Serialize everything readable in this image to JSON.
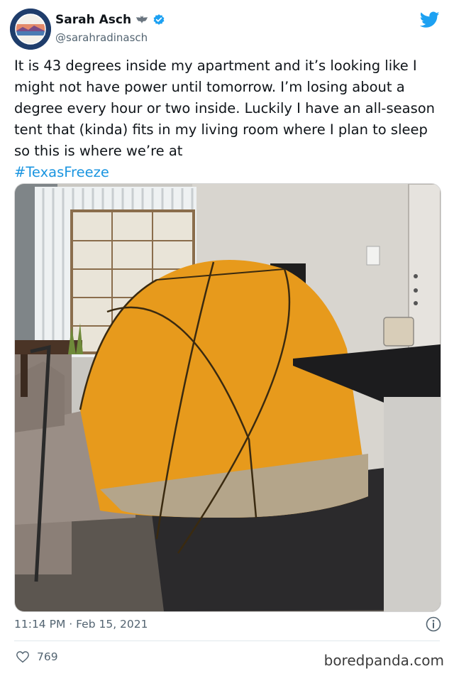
{
  "author": {
    "name": "Sarah Asch",
    "handle": "@sarahradinasch",
    "verified": true,
    "avatar_icon": "austin-newsgroup-logo"
  },
  "tweet": {
    "text": "It is 43 degrees inside my apartment and it’s looking like I might not have power until tomorrow. I’m losing about a degree every hour or two inside. Luckily I have an all-season tent that (kinda) fits in my living room where I plan to sleep so this is where we’re at",
    "hashtag": "#TexasFreeze",
    "timestamp": "11:14 PM · Feb 15, 2021"
  },
  "engagement": {
    "likes": "769"
  },
  "watermark": "boredpanda.com",
  "colors": {
    "link": "#1b95e0",
    "twitter_blue": "#1da1f2",
    "tent_orange": "#e79a1c"
  },
  "icons": [
    "bat-icon",
    "verified-badge-icon",
    "twitter-bird-icon",
    "info-icon",
    "heart-icon"
  ]
}
